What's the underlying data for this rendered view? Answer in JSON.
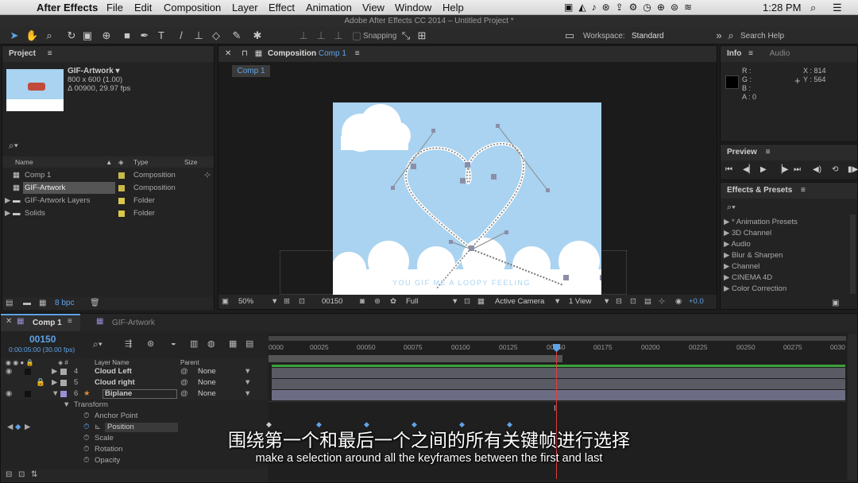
{
  "menubar": {
    "apple": "",
    "items": [
      "After Effects",
      "File",
      "Edit",
      "Composition",
      "Layer",
      "Effect",
      "Animation",
      "View",
      "Window",
      "Help"
    ],
    "clock": "1:28 PM"
  },
  "window_title": "Adobe After Effects CC 2014 – Untitled Project *",
  "toolbar": {
    "snapping": "Snapping",
    "workspace_label": "Workspace:",
    "workspace": "Standard",
    "search_help": "Search Help"
  },
  "project": {
    "tab": "Project",
    "asset_name": "GIF-Artwork ▾",
    "asset_info1": "800 x 600 (1.00)",
    "asset_info2": "Δ 00900, 29.97 fps",
    "search_placeholder": "",
    "col_name": "Name",
    "col_type": "Type",
    "col_size": "Size",
    "items": [
      {
        "name": "Comp 1",
        "type": "Composition",
        "color": "#c8b94a"
      },
      {
        "name": "GIF-Artwork",
        "type": "Composition",
        "color": "#c8b94a"
      },
      {
        "name": "GIF-Artwork Layers",
        "type": "Folder",
        "color": "#d9c84c"
      },
      {
        "name": "Solids",
        "type": "Folder",
        "color": "#d9c84c"
      }
    ],
    "bpc": "8 bpc"
  },
  "composition": {
    "tab_label": "Composition",
    "tab_name": "Comp 1",
    "subtab": "Comp 1",
    "zoom": "50%",
    "timecode": "00150",
    "resolution": "Full",
    "camera": "Active Camera",
    "view": "1 View",
    "exposure": "+0.0",
    "artwork_text": "YOU GIF ME A LOOPY FEELING"
  },
  "info": {
    "tab": "Info",
    "tab2": "Audio",
    "r": "R :",
    "g": "G :",
    "b": "B :",
    "a": "A : 0",
    "x": "X : 814",
    "y": "Y : 564"
  },
  "preview": {
    "tab": "Preview"
  },
  "effects": {
    "tab": "Effects & Presets",
    "search_placeholder": "",
    "items": [
      "* Animation Presets",
      "3D Channel",
      "Audio",
      "Blur & Sharpen",
      "Channel",
      "CINEMA 4D",
      "Color Correction"
    ]
  },
  "timeline": {
    "tab1": "Comp 1",
    "tab2": "GIF-Artwork",
    "timecode": "00150",
    "timecode_sub": "0:00:05:00 (30.00 fps)",
    "search_placeholder": "",
    "col_layer": "Layer Name",
    "col_parent": "Parent",
    "ruler": [
      "0000",
      "00025",
      "00050",
      "00075",
      "00100",
      "00125",
      "00150",
      "00175",
      "00200",
      "00225",
      "00250",
      "00275",
      "0030"
    ],
    "layers": [
      {
        "num": "4",
        "name": "Cloud Left",
        "parent": "None"
      },
      {
        "num": "5",
        "name": "Cloud right",
        "parent": "None"
      },
      {
        "num": "6",
        "name": "Biplane",
        "parent": "None"
      }
    ],
    "transform": "Transform",
    "props": [
      "Anchor Point",
      "Position",
      "Scale",
      "Rotation",
      "Opacity"
    ]
  },
  "subtitles": {
    "zh": "围绕第一个和最后一个之间的所有关键帧进行选择",
    "en": "make a selection around all the keyframes between the first and last"
  }
}
